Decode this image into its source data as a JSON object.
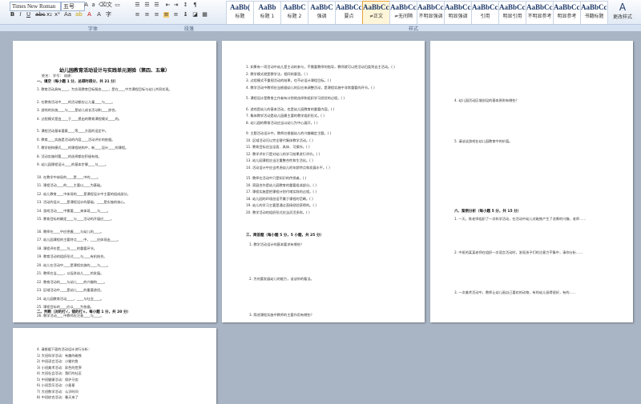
{
  "ribbon": {
    "font_name": "Times New Roman",
    "font_size": "五号",
    "group_labels": {
      "font": "字体",
      "paragraph": "段落",
      "styles": "样式"
    },
    "styles": [
      {
        "preview": "AaBb(",
        "name": "标题"
      },
      {
        "preview": "AaBb",
        "name": "标题 1"
      },
      {
        "preview": "AaBbC",
        "name": "标题 2"
      },
      {
        "preview": "AaBbC",
        "name": "强调"
      },
      {
        "preview": "AaBbCcD",
        "name": "要点"
      },
      {
        "preview": "AaBbCcD",
        "name": "≠正文"
      },
      {
        "preview": "AaBbCcD",
        "name": "≠无间隔"
      },
      {
        "preview": "AaBbCcD",
        "name": "不明显强调"
      },
      {
        "preview": "AaBbCcD",
        "name": "明显强调"
      },
      {
        "preview": "AaBbCcD",
        "name": "引用"
      },
      {
        "preview": "AaBbCcD",
        "name": "明显引用"
      },
      {
        "preview": "AaBbCcD",
        "name": "不明显参考"
      },
      {
        "preview": "AaBbCcI",
        "name": "明显参考"
      },
      {
        "preview": "AaBbCcI",
        "name": "书籍标题"
      }
    ],
    "edit_label": "更改样式"
  },
  "page1": {
    "title": "幼儿园教育活动设计与实践单元测验（第四、五章）",
    "subtitle": "姓名：      学号：      成绩：",
    "section1": "一、填空（每小题 1 分，总得时得分，共 21 分）",
    "lines": [
      "1. 教育活动具有____，为实现教育目标服务____，是在____中为课程目标与幼儿共同实现。",
      "2. 在教育活动中____的活动都应让儿童____与____。",
      "3. 游戏的实施____与____是幼儿成长活动和____综合。",
      "4. 过程模式是由____于____提出的教育课程模式____的。",
      "5. 课程活动基本要素____等____方面的设定中。",
      "6. 教育____实施是活动的内容____活动评价的依据。",
      "7. 教学结构模式____的课程结构中，新____设计____的课程。",
      "8. 活动实施时要____的选择都应积极有效。",
      "9. 幼儿园课程设计____的基本步骤____与____。",
      "10. 在教学中体现的____是____中的____。",
      "11. 课程活动____的____主要以____为基础。",
      "12. 幼儿教育____中体现的____是课程设计中主要的组成部分。",
      "13. 活动的设计____是课程设计的基础，____是实施的核心。",
      "14. 游戏活动____中需要____来体现____与____。",
      "15. 教育目标的确定____与____活动的开展应____。",
      "16. 教师在____中应把握____与幼儿的____。",
      "17. 幼儿园课程的主要特点____中，____应体现出____。",
      "18. 课程评价是____与____的重要环节。",
      "19. 教育活动的组织形式____与____有机结合。",
      "20. 幼儿在活动中____是课程实施的____与____。",
      "21. 教师应当____，以促进幼儿____的发展。",
      "22. 教育活动的____与幼儿____的兴趣和____。",
      "23. 区域活动中____是幼儿____的重要途径。",
      "24. 幼儿园教育活动____，____与社会____。",
      "25. 课程目标的____应以____为依据。",
      "26. 教学活动____中教师应注意____与____。"
    ],
    "section2": "二、判断（对的打√，错的打×，每小题 1 分，共 20 分）"
  },
  "page2": {
    "lines": [
      "1. 如果有一项活动中幼儿是主动的参与，不需要教师的指导，教师就可以把活动归类到自主活动。( )",
      "2. 教学模式就是教学法，相同的意思。( )",
      "3. 过程模式不重视活动的结果，也不必设计课程目标。( )",
      "4. 教学活动中教师应当根据幼儿的反应来调整活动，是课程实施中非常重要的环节。( )",
      "5. 课程设计是教育工作者有计划地选择和组织学习经验的过程。( )",
      "6. 游戏是幼儿的基本活动，也是幼儿园教育的重要内容。( )",
      "7. 集体教学活动是幼儿园最主要的教学组织形式。( )",
      "8. 幼儿园的教育活动应当以幼儿为中心展开。( )",
      "9. 主题活动设计中，教师应根据幼儿的兴趣确定主题。( )",
      "10. 区域活动可以完全替代集体教学活动。( )",
      "11. 教育目标应当全面、具体、可操作。( )",
      "12. 教学评价只是对幼儿的学习结果进行评价。( )",
      "13. 幼儿园课程应当注重整合性和生活化。( )",
      "14. 活动设计中应当考虑幼儿的年龄特点和发展水平。( )",
      "15. 教师在活动中只是知识的传授者。( )",
      "16. 家园合作是幼儿园教育的重要组成部分。( )",
      "17. 课程实施是把课程计划付诸实践的过程。( )",
      "18. 幼儿园的环境创设不属于课程的范畴。( )",
      "19. 幼儿的学习主要是通过直接经验获得的。( )",
      "20. 教学活动的组织形式应当灵活多样。( )"
    ],
    "section3": "三、简答题（每小题 5 分，5 小题，共 25 分）",
    "questions": [
      "1. 教学活动设计的基本要求有哪些？",
      "2. 为何要发展幼儿的能力，谈谈你的看法。",
      "3. 简述课程实施中教师的主要作用有哪些？"
    ]
  },
  "page3": {
    "questions": [
      "4. 幼儿园活动区域创设的基本原则有哪些？",
      "5. 请谈谈游戏在幼儿园教育中的价值。"
    ],
    "section4": "六、案例分析（每小题 5 分，共 15 分）",
    "cases": [
      "1. 一天，陈老师组织了一次科学活动，在活动中幼儿对磁铁产生了浓厚的兴趣，老师……",
      "2. 中班的某某老师在组织一次语言活动时，发现孩子们的注意力不集中，请你分析……",
      "3. 一次美术活动中，教师让幼儿画自己喜欢的动物，有的幼儿画得很好，有的……"
    ]
  },
  "page4": {
    "lines": [
      "4. 请根据下面的活动设计进行分析：",
      "1) 大班科学活动：有趣的磁铁",
      "2) 中班语言活动：小猫钓鱼",
      "3) 小班美术活动：彩色的世界",
      "4) 大班社会活动：我们的社区",
      "5) 中班健康活动：保护牙齿",
      "6) 小班音乐活动：小星星",
      "7) 大班数学活动：认识时间",
      "8) 中班综合活动：春天来了"
    ]
  }
}
